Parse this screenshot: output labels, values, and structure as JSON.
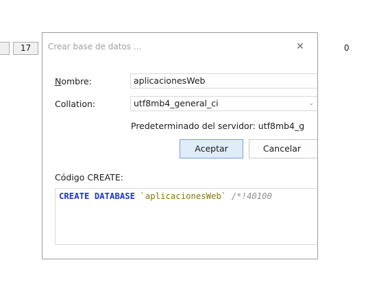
{
  "background": {
    "number_field": "17",
    "right_value": "0"
  },
  "dialog": {
    "title": "Crear base de datos ...",
    "name_label": "Nombre:",
    "name_value": "aplicacionesWeb",
    "collation_label": "Collation:",
    "collation_value": "utf8mb4_general_ci",
    "server_default": "Predeterminado del servidor: utf8mb4_g",
    "ok_label": "Aceptar",
    "cancel_label": "Cancelar",
    "code_label": "Código CREATE:",
    "code": {
      "keyword1": "CREATE",
      "keyword2": "DATABASE",
      "identifier": "`aplicacionesWeb`",
      "comment": "/*!40100"
    }
  },
  "colors": {
    "accent_border": "#6f9fdf",
    "accent_fill": "#e1ecf9",
    "sql_keyword": "#1d36c5",
    "sql_string": "#7d7a0a",
    "sql_comment": "#8c8c8c"
  },
  "icons": {
    "close": "close-icon",
    "dropdown": "chevron-down-icon"
  }
}
